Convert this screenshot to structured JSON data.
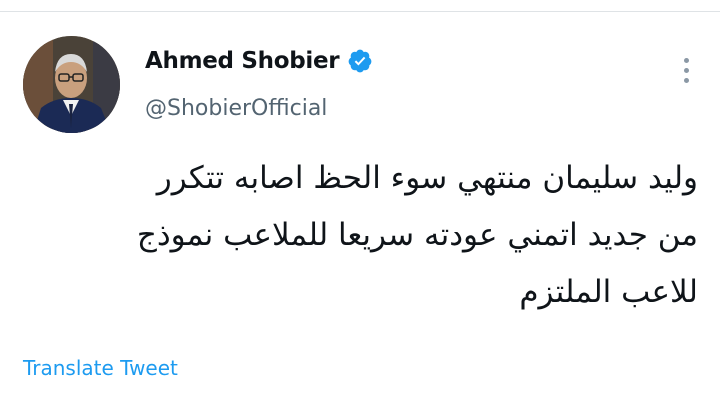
{
  "author": {
    "display_name": "Ahmed Shobier",
    "handle": "@ShobierOfficial",
    "verified": true,
    "avatar_icon": "user-avatar"
  },
  "tweet": {
    "text_lines": [
      "وليد سليمان منتهي سوء الحظ اصابه تتكرر",
      "من جديد اتمني عودته سريعا للملاعب نموذج",
      "للاعب الملتزم"
    ]
  },
  "actions": {
    "translate_label": "Translate Tweet",
    "more_icon": "more-options-icon"
  },
  "colors": {
    "link": "#1d9bf0",
    "verified_badge": "#1d9bf0",
    "secondary_text": "#536471"
  }
}
